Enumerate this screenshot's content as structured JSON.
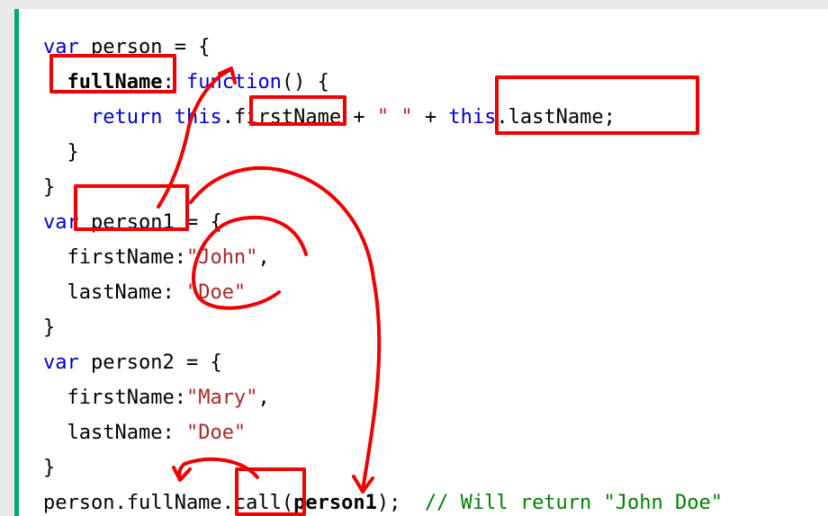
{
  "code": {
    "line1": {
      "kw": "var",
      "rest": " person = {"
    },
    "line2": {
      "indent": "  ",
      "name": "fullName",
      "colon": ": ",
      "kw": "function",
      "rest": "() {"
    },
    "line3": {
      "indent": "    ",
      "kw1": "return",
      "sp": " ",
      "kw2": "this",
      "mid": ".firstName + ",
      "str": "\" \"",
      "plus": " + ",
      "kw3": "this",
      "rest": ".lastName;"
    },
    "line4": {
      "text": "  }"
    },
    "line5": {
      "text": "}"
    },
    "line6": {
      "kw": "var",
      "rest": " person1 = {"
    },
    "line7": {
      "indent": "  ",
      "key": "firstName:",
      "str": "\"John\"",
      "rest": ","
    },
    "line8": {
      "indent": "  ",
      "key": "lastName: ",
      "str": "\"Doe\""
    },
    "line9": {
      "text": "}"
    },
    "line10": {
      "kw": "var",
      "rest": " person2 = {"
    },
    "line11": {
      "indent": "  ",
      "key": "firstName:",
      "str": "\"Mary\"",
      "rest": ","
    },
    "line12": {
      "indent": "  ",
      "key": "lastName: ",
      "str": "\"Doe\""
    },
    "line13": {
      "text": "}"
    },
    "line14": {
      "pre": "person.fullName.call(",
      "arg": "person1",
      "post": ");  ",
      "comment": "// Will return \"John Doe\""
    }
  },
  "colors": {
    "keyword": "#0000cd",
    "string": "#a52a2a",
    "comment": "#008000",
    "accent_border": "#04aa6d",
    "annotation": "#ee0000"
  }
}
